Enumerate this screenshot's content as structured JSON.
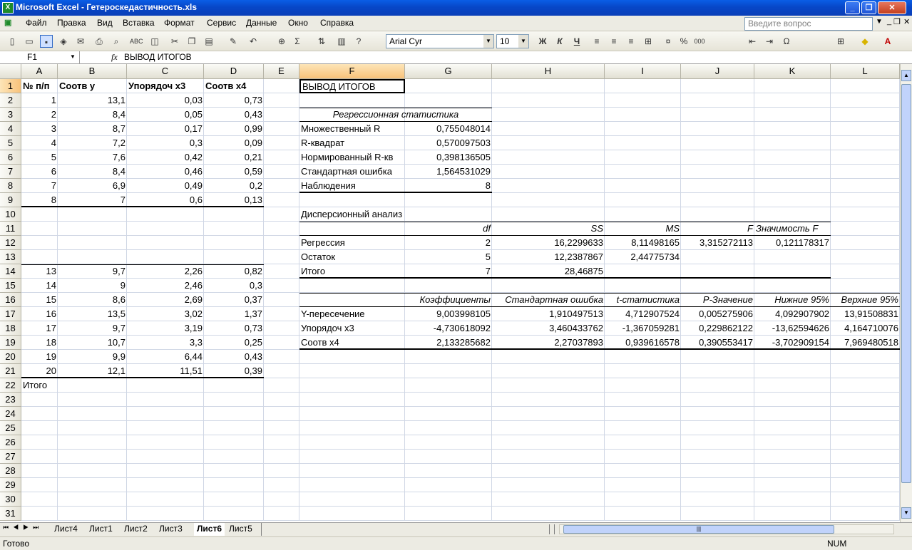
{
  "window": {
    "title": "Microsoft Excel - Гетероскедастичность.xls",
    "app_icon": "X"
  },
  "menu": [
    "Файл",
    "Правка",
    "Вид",
    "Вставка",
    "Формат",
    "Сервис",
    "Данные",
    "Окно",
    "Справка"
  ],
  "ask_placeholder": "Введите вопрос",
  "toolbar": {
    "font": "Arial Cyr",
    "size": "10"
  },
  "formula": {
    "cell": "F1",
    "fx": "fx",
    "content": "ВЫВОД ИТОГОВ"
  },
  "columns": [
    "A",
    "B",
    "C",
    "D",
    "E",
    "F",
    "G",
    "H",
    "I",
    "J",
    "K",
    "L"
  ],
  "selected_col": "F",
  "selected_row": "1",
  "rows": [
    "1",
    "2",
    "3",
    "4",
    "5",
    "6",
    "7",
    "8",
    "9",
    "10",
    "11",
    "12",
    "13",
    "14",
    "15",
    "16",
    "17",
    "18",
    "19",
    "20",
    "21",
    "22",
    "23",
    "24",
    "25",
    "26",
    "27",
    "28",
    "29",
    "30",
    "31"
  ],
  "table_left": {
    "headers": [
      "№ п/п",
      "Соотв y",
      "Упорядоч x3",
      "Соотв x4"
    ],
    "top": [
      [
        "1",
        "13,1",
        "0,03",
        "0,73"
      ],
      [
        "2",
        "8,4",
        "0,05",
        "0,43"
      ],
      [
        "3",
        "8,7",
        "0,17",
        "0,99"
      ],
      [
        "4",
        "7,2",
        "0,3",
        "0,09"
      ],
      [
        "5",
        "7,6",
        "0,42",
        "0,21"
      ],
      [
        "6",
        "8,4",
        "0,46",
        "0,59"
      ],
      [
        "7",
        "6,9",
        "0,49",
        "0,2"
      ],
      [
        "8",
        "7",
        "0,6",
        "0,13"
      ]
    ],
    "bottom": [
      [
        "13",
        "9,7",
        "2,26",
        "0,82"
      ],
      [
        "14",
        "9",
        "2,46",
        "0,3"
      ],
      [
        "15",
        "8,6",
        "2,69",
        "0,37"
      ],
      [
        "16",
        "13,5",
        "3,02",
        "1,37"
      ],
      [
        "17",
        "9,7",
        "3,19",
        "0,73"
      ],
      [
        "18",
        "10,7",
        "3,3",
        "0,25"
      ],
      [
        "19",
        "9,9",
        "6,44",
        "0,43"
      ],
      [
        "20",
        "12,1",
        "11,51",
        "0,39"
      ]
    ],
    "total_label": "Итого"
  },
  "output": {
    "title": "ВЫВОД ИТОГОВ",
    "reg_stats_title": "Регрессионная статистика",
    "reg_stats": [
      [
        "Множественный R",
        "0,755048014"
      ],
      [
        "R-квадрат",
        "0,570097503"
      ],
      [
        "Нормированный R-кв",
        "0,398136505"
      ],
      [
        "Стандартная ошибка",
        "1,564531029"
      ],
      [
        "Наблюдения",
        "8"
      ]
    ],
    "anova_title": "Дисперсионный анализ",
    "anova_headers": [
      "df",
      "SS",
      "MS",
      "F",
      "Значимость F"
    ],
    "anova": [
      [
        "Регрессия",
        "2",
        "16,2299633",
        "8,11498165",
        "3,315272113",
        "0,121178317"
      ],
      [
        "Остаток",
        "5",
        "12,2387867",
        "2,44775734",
        "",
        ""
      ],
      [
        "Итого",
        "7",
        "28,46875",
        "",
        "",
        ""
      ]
    ],
    "coef_headers": [
      "Коэффициенты",
      "Стандартная ошибка",
      "t-статистика",
      "P-Значение",
      "Нижние 95%",
      "Верхние 95%"
    ],
    "coef": [
      [
        "Y-пересечение",
        "9,003998105",
        "1,910497513",
        "4,712907524",
        "0,005275906",
        "4,092907902",
        "13,91508831"
      ],
      [
        "Упорядоч x3",
        "-4,730618092",
        "3,460433762",
        "-1,367059281",
        "0,229862122",
        "-13,62594626",
        "4,164710076"
      ],
      [
        "Соотв x4",
        "2,133285682",
        "2,27037893",
        "0,939616578",
        "0,390553417",
        "-3,702909154",
        "7,969480518"
      ]
    ]
  },
  "sheets": [
    "Лист4",
    "Лист1",
    "Лист2",
    "Лист3",
    "Лист6",
    "Лист5"
  ],
  "active_sheet": "Лист6",
  "status": {
    "left": "Готово",
    "num": "NUM"
  }
}
